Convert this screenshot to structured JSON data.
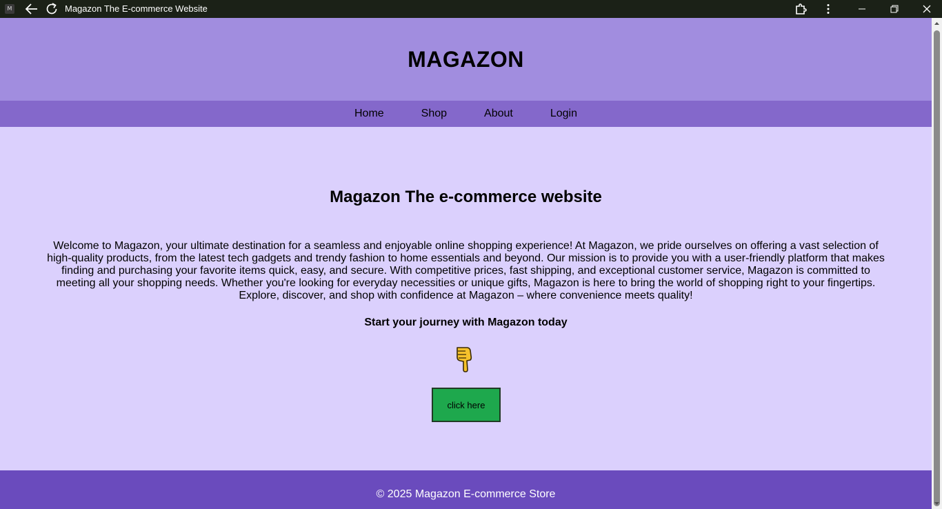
{
  "window": {
    "app_icon_letter": "M",
    "title": "Magazon The E-commerce Website"
  },
  "header": {
    "logo": "MAGAZON"
  },
  "nav": {
    "items": [
      {
        "label": "Home"
      },
      {
        "label": "Shop"
      },
      {
        "label": "About"
      },
      {
        "label": "Login"
      }
    ]
  },
  "main": {
    "title": "Magazon The e-commerce website",
    "description": "Welcome to Magazon, your ultimate destination for a seamless and enjoyable online shopping experience! At Magazon, we pride ourselves on offering a vast selection of high-quality products, from the latest tech gadgets and trendy fashion to home essentials and beyond. Our mission is to provide you with a user-friendly platform that makes finding and purchasing your favorite items quick, easy, and secure. With competitive prices, fast shipping, and exceptional customer service, Magazon is committed to meeting all your shopping needs. Whether you're looking for everyday necessities or unique gifts, Magazon is here to bring the world of shopping right to your fingertips. Explore, discover, and shop with confidence at Magazon – where convenience meets quality!",
    "cta_text": "Start your journey with Magazon today",
    "pointer_icon": "pointing-down-hand-icon",
    "button_label": "click here"
  },
  "footer": {
    "text": "© 2025 Magazon E-commerce Store"
  },
  "colors": {
    "titlebar": "#1b2117",
    "header": "#a18ddf",
    "nav": "#8468cb",
    "page": "#dbd0fd",
    "button": "#1ea84d",
    "footer": "#6a4bbd"
  }
}
